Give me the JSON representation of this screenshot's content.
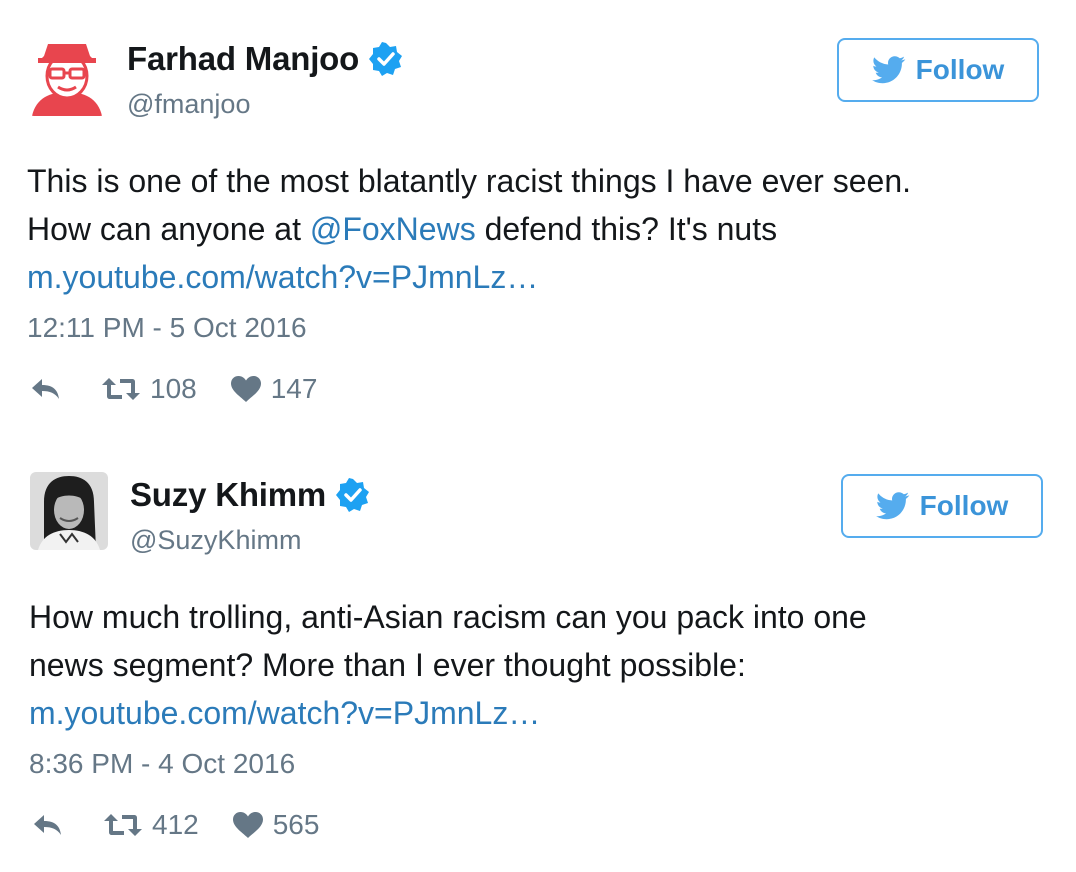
{
  "tweets": [
    {
      "author": {
        "name": "Farhad Manjoo",
        "handle": "@fmanjoo",
        "verified": true,
        "avatar": "cartoon-avatar-red-hat"
      },
      "follow_label": "Follow",
      "text": {
        "line1": "This is one of the most blatantly racist things I have ever seen.",
        "line2_before": "How can anyone at ",
        "mention": "@FoxNews",
        "line2_after": " defend this? It's nuts",
        "link": "m.youtube.com/watch?v=PJmnLz…"
      },
      "timestamp": "12:11 PM - 5 Oct 2016",
      "retweets": "108",
      "likes": "147"
    },
    {
      "author": {
        "name": "Suzy Khimm",
        "handle": "@SuzyKhimm",
        "verified": true,
        "avatar": "photo-avatar-bw"
      },
      "follow_label": "Follow",
      "text": {
        "line1": "How much trolling, anti-Asian racism can you pack into one",
        "line2": "news segment? More than I ever thought possible:",
        "link": "m.youtube.com/watch?v=PJmnLz…"
      },
      "timestamp": "8:36 PM - 4 Oct 2016",
      "retweets": "412",
      "likes": "565"
    }
  ],
  "colors": {
    "link": "#2b7bb9",
    "follow_border": "#55acee",
    "muted": "#657786",
    "verified": "#1da1f2",
    "text": "#14171a"
  },
  "icons": [
    "twitter-bird-icon",
    "verified-badge-icon",
    "reply-icon",
    "retweet-icon",
    "heart-icon"
  ]
}
